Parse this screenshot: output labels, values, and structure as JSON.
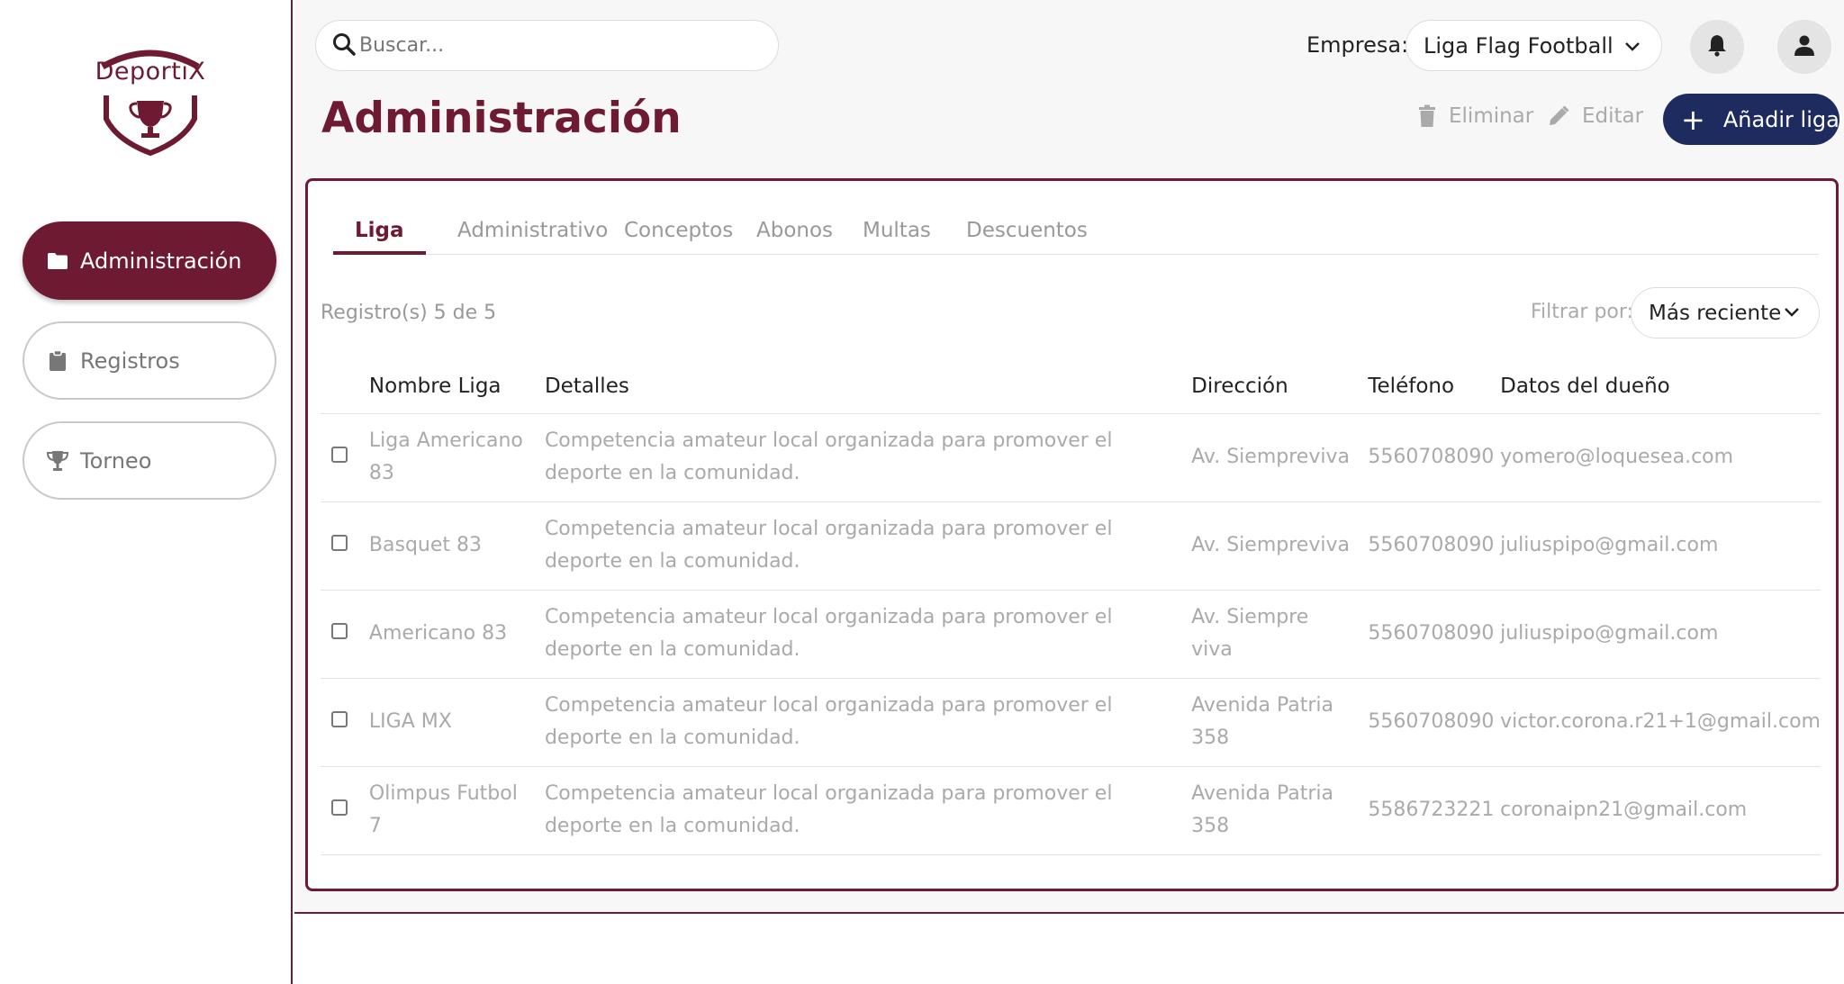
{
  "app": {
    "brand": "DeportiX"
  },
  "sidebar": {
    "items": [
      {
        "label": "Administración",
        "icon": "folder-icon",
        "active": true
      },
      {
        "label": "Registros",
        "icon": "clipboard-icon",
        "active": false
      },
      {
        "label": "Torneo",
        "icon": "trophy-icon",
        "active": false
      }
    ]
  },
  "header": {
    "search_placeholder": "Buscar...",
    "empresa_label": "Empresa:",
    "empresa_value": "Liga Flag Football"
  },
  "page": {
    "title": "Administración",
    "delete_label": "Eliminar",
    "edit_label": "Editar",
    "add_label": "Añadir liga"
  },
  "tabs": [
    "Liga",
    "Administrativo",
    "Conceptos",
    "Abonos",
    "Multas",
    "Descuentos"
  ],
  "registro_text": "Registro(s) 5 de 5",
  "filter": {
    "label": "Filtrar por:",
    "value": "Más reciente"
  },
  "table": {
    "headers": [
      "Nombre Liga",
      "Detalles",
      "Dirección",
      "Teléfono",
      "Datos del dueño"
    ],
    "rows": [
      {
        "nombre": "Liga Americano 83",
        "detalles": "Competencia amateur local organizada para promover el deporte en la comunidad.",
        "direccion": "Av. Siempreviva",
        "telefono": "5560708090",
        "dueno": "yomero@loquesea.com"
      },
      {
        "nombre": "Basquet 83",
        "detalles": "Competencia amateur local organizada para promover el deporte en la comunidad.",
        "direccion": "Av. Siempreviva",
        "telefono": "5560708090",
        "dueno": "juliuspipo@gmail.com"
      },
      {
        "nombre": "Americano 83",
        "detalles": "Competencia amateur local organizada para promover el deporte en la comunidad.",
        "direccion": "Av. Siempre viva",
        "telefono": "5560708090",
        "dueno": "juliuspipo@gmail.com"
      },
      {
        "nombre": "LIGA MX",
        "detalles": "Competencia amateur local organizada para promover el deporte en la comunidad.",
        "direccion": "Avenida Patria 358",
        "telefono": "5560708090",
        "dueno": "victor.corona.r21+1@gmail.com"
      },
      {
        "nombre": "Olimpus Futbol 7",
        "detalles": "Competencia amateur local organizada para promover el deporte en la comunidad.",
        "direccion": "Avenida Patria 358",
        "telefono": "5586723221",
        "dueno": "coronaipn21@gmail.com"
      }
    ]
  },
  "colors": {
    "brand": "#6e1a33",
    "primary_button": "#1d2b5e"
  }
}
